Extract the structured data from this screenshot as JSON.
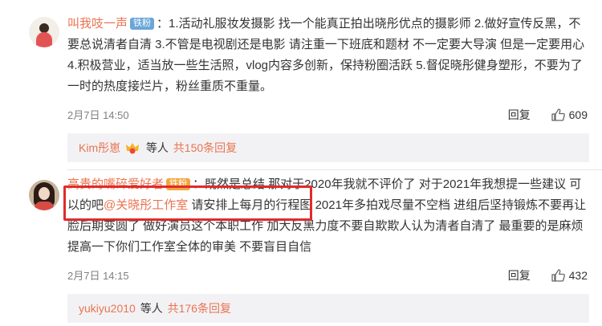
{
  "comments": [
    {
      "username": "叫我吱一声",
      "badge": "铁粉",
      "text_lines": [
        "：1.活动礼服妆发摄影 找一个能真正拍出晓彤优点的摄影师 2.做好宣传反黑，不",
        "要总说清者自清 3.不管是电视剧还是电影 请注重一下班底和题材 不一定要大导演 但是一定要用心",
        "4.积极营业，适当放一些生活照，vlog内容多创新，保持粉圈活跃 5.督促晓彤健身塑形，不要为了",
        "一时的热度接烂片，粉丝重质不重量。"
      ],
      "time": "2月7日 14:50",
      "reply_label": "回复",
      "likes": "609",
      "sub": {
        "name": "Kim彤崽",
        "etc": "等人",
        "total": "共150条回复"
      }
    },
    {
      "username": "高贵的嘴碎爱好者",
      "badge": "铁粉",
      "line1": "：既然是总结 那对于2020年我就不评价了 对于2021年我想提一些建议 可",
      "line2_pre": "以的吧",
      "mention": "@关晓彤工作室",
      "line2_post": " 请安排上每月的行程图 2021年多拍戏尽量不空档 进组后坚持锻炼不要再让",
      "line3": "脸后期变圆了 做好演员这个本职工作 加大反黑力度不要自欺欺人认为清者自清了 最重要的是麻烦",
      "line4": "提高一下你们工作室全体的审美 不要盲目自信",
      "time": "2月7日 14:15",
      "reply_label": "回复",
      "likes": "432",
      "sub": {
        "name": "yukiyu2010",
        "etc": "等人",
        "total": "共176条回复"
      }
    }
  ]
}
